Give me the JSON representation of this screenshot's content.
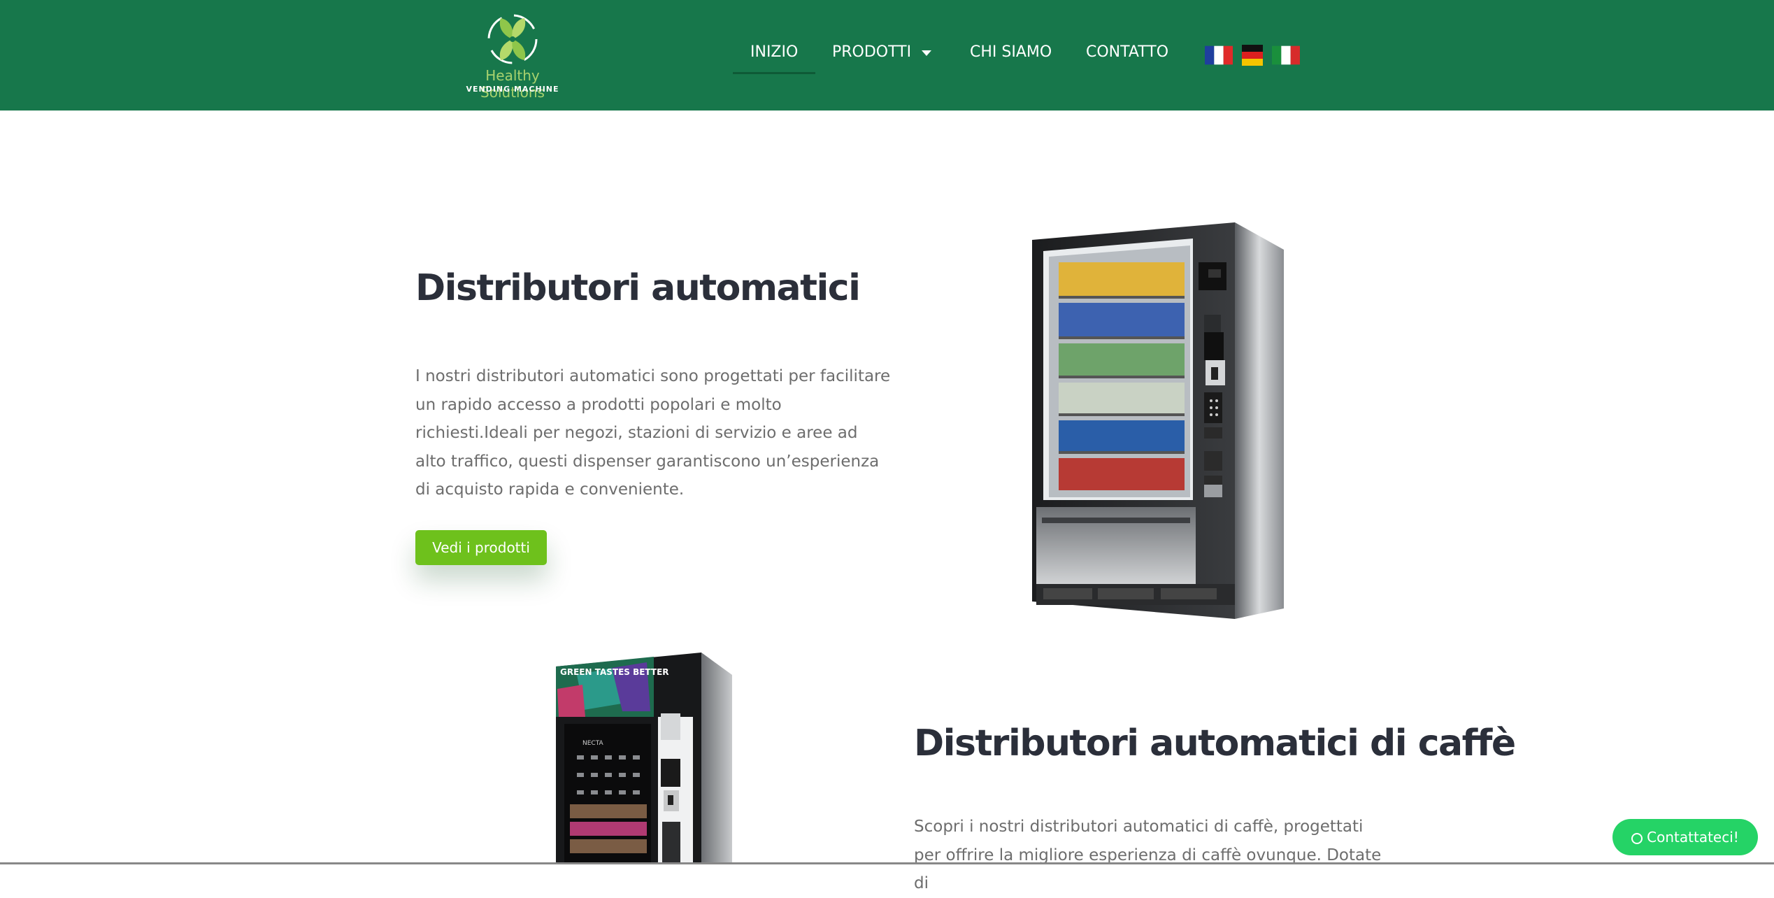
{
  "brand": {
    "name": "Healthy Solutions",
    "tagline": "VENDING MACHINE",
    "logo_icon": "leaf-logo-icon",
    "colors": {
      "header_bg": "#17774b",
      "logo_green": "#a8d26e",
      "cta_green": "#6ec11c",
      "whatsapp_green": "#25d366"
    }
  },
  "nav": {
    "items": [
      {
        "label": "INIZIO",
        "active": true
      },
      {
        "label": "PRODOTTI",
        "has_dropdown": true
      },
      {
        "label": "CHI SIAMO"
      },
      {
        "label": "CONTATTO"
      }
    ],
    "languages": [
      "fr-flag-icon",
      "de-flag-icon",
      "it-flag-icon"
    ]
  },
  "section1": {
    "title": "Distributori automatici",
    "text": "I nostri distributori automatici sono progettati per facilitare un rapido accesso a prodotti popolari e molto richiesti.Ideali per negozi, stazioni di servizio e aree ad alto traffico, questi dispenser garantiscono un’esperienza di acquisto rapida e conveniente.",
    "button": "Vedi i prodotti",
    "image": "snack-vending-machine-image"
  },
  "section2": {
    "title": "Distributori automatici di caffè",
    "text": "Scopri i nostri distributori automatici di caffè, progettati per offrire la migliore esperienza di caffè ovunque. Dotate di",
    "image": "coffee-vending-machine-image",
    "machine_brand": "NECTA",
    "machine_slogan": "GREEN TASTES BETTER"
  },
  "whatsapp": {
    "label": "Contattateci!",
    "icon": "whatsapp-icon"
  }
}
